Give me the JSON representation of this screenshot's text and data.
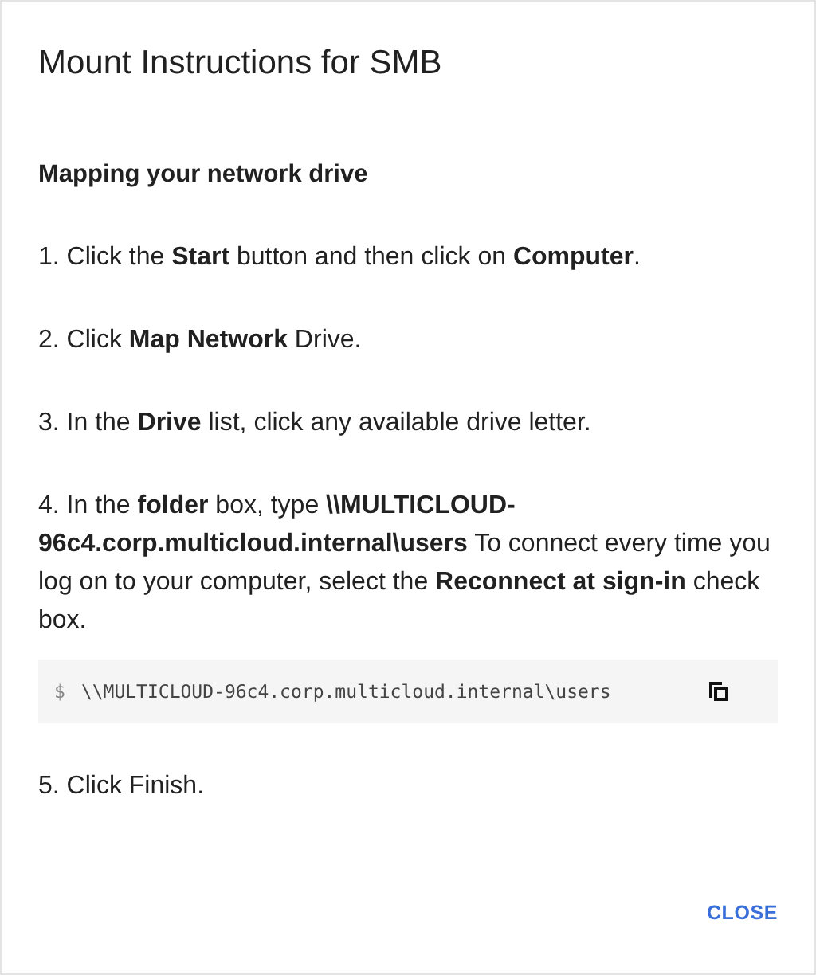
{
  "dialog": {
    "title": "Mount Instructions for SMB",
    "heading": "Mapping your network drive",
    "steps": [
      {
        "kind": "text",
        "text": "1. Click the **Start** button and then click on **Computer**."
      },
      {
        "kind": "text",
        "text": "2. Click **Map Network** Drive."
      },
      {
        "kind": "text",
        "text": "3. In the **Drive** list, click any available drive letter."
      },
      {
        "kind": "text",
        "text": "4. In the **folder** box, type **\\\\MULTICLOUD-96c4.corp.multicloud.internal\\users** To connect every time you log on to your computer, select the **Reconnect at sign-in** check box."
      },
      {
        "kind": "code",
        "prompt": "$",
        "text": "\\\\MULTICLOUD-96c4.corp.multicloud.internal\\users"
      },
      {
        "kind": "text",
        "text": "5. Click Finish."
      }
    ],
    "buttons": [
      "CLOSE"
    ]
  }
}
